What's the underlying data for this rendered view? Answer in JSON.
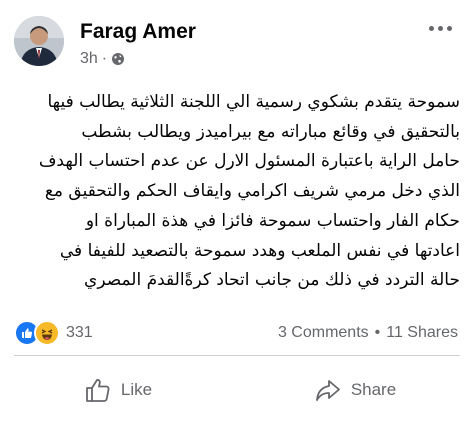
{
  "post": {
    "author": "Farag Amer",
    "time": "3h",
    "separator": "·",
    "privacy_icon": "globe-icon",
    "text": "سموحة يتقدم بشكوي رسمية الي اللجنة الثلاثية يطالب فيها\nبالتحقيق في وقائع مباراته مع بيراميدز  ويطالب بشطب\nحامل الراية باعتبارة المسئول الارل عن عدم احتساب الهدف\nالذي دخل مرمي شريف اكرامي وايقاف الحكم والتحقيق مع\nحكام الفار  واحتساب سموحة فائزا في هذة المباراة او\nاعادتها في نفس الملعب وهدد سموحة بالتصعيد للفيفا في\nحالة التردد في ذلك من جانب اتحاد كرةًالقدمَ المصري"
  },
  "stats": {
    "reaction_icons": [
      "like-icon",
      "laugh-icon"
    ],
    "reaction_count": "331",
    "comments": "3 Comments",
    "dot": "•",
    "shares": "11 Shares"
  },
  "actions": {
    "like_label": "Like",
    "share_label": "Share"
  },
  "colors": {
    "like_blue": "#1877f2",
    "haha_yellow": "#f7b928",
    "secondary_text": "#65676b",
    "divider": "#ced0d4"
  }
}
